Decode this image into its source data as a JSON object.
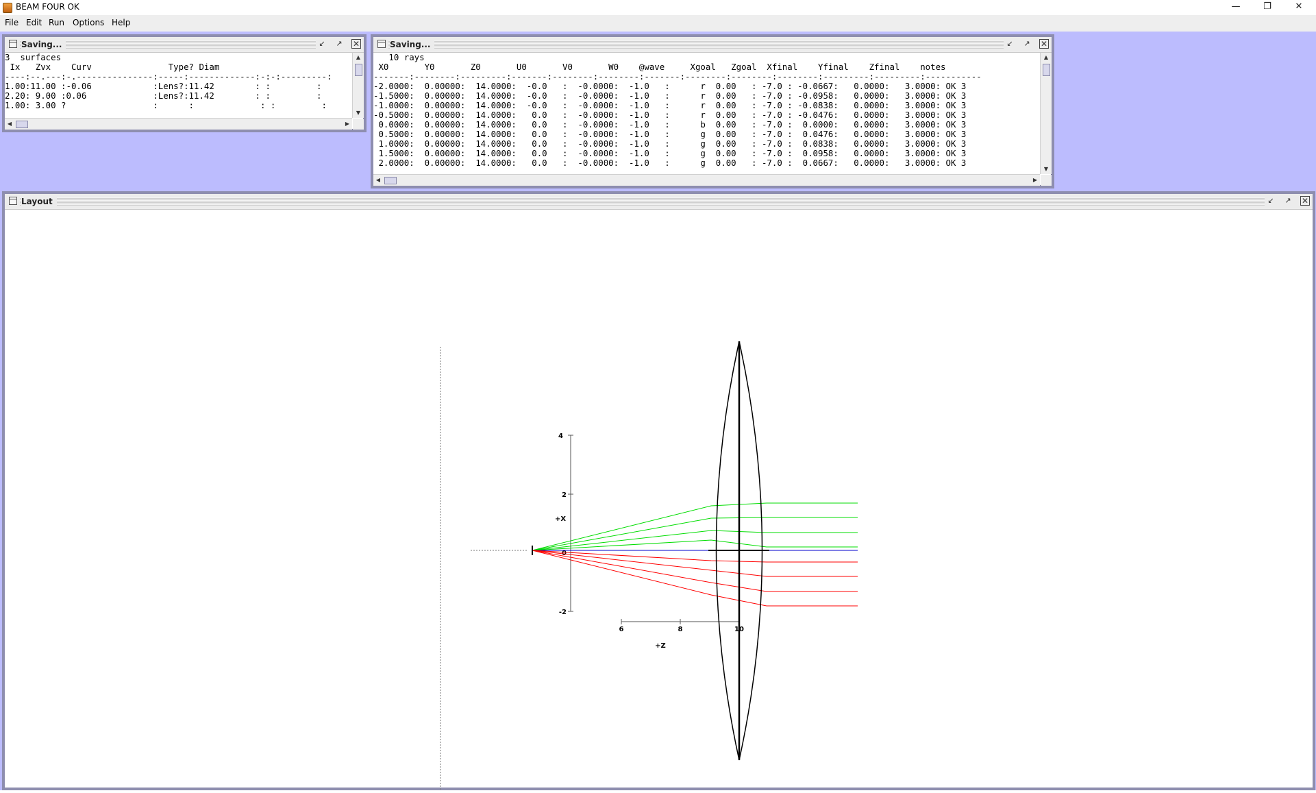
{
  "window": {
    "title": "BEAM FOUR  OK",
    "minimize_icon": "minimize-icon",
    "restore_icon": "restore-icon",
    "close_icon": "close-icon"
  },
  "menu": [
    "File",
    "Edit",
    "Run",
    "Options",
    "Help"
  ],
  "optics_frame": {
    "title": "Saving...",
    "lines": [
      "3  surfaces",
      " Ix   Zvx    Curv               Type? Diam",
      "----:--.---:-.---------------:-----:-------------:-:-:---------:",
      "1.00:11.00 :-0.06            :Lens?:11.42        : :         :",
      "2.20: 9.00 :0.06             :Lens?:11.42        : :         :",
      "1.00: 3.00 ?                 :      :             : :         :"
    ]
  },
  "rays_frame": {
    "title": "Saving...",
    "lines": [
      "   10 rays",
      " X0       Y0       Z0       U0       V0       W0    @wave     Xgoal   Zgoal  Xfinal    Yfinal    Zfinal    notes",
      "-------:--------:---------:-------:--------:--------:-------:--------:--------:--------:---------:---------:-----------",
      "-2.0000:  0.00000:  14.0000:  -0.0   :  -0.0000:  -1.0   :      r  0.00   : -7.0 : -0.0667:   0.0000:   3.0000: OK 3",
      "-1.5000:  0.00000:  14.0000:  -0.0   :  -0.0000:  -1.0   :      r  0.00   : -7.0 : -0.0958:   0.0000:   3.0000: OK 3",
      "-1.0000:  0.00000:  14.0000:  -0.0   :  -0.0000:  -1.0   :      r  0.00   : -7.0 : -0.0838:   0.0000:   3.0000: OK 3",
      "-0.5000:  0.00000:  14.0000:   0.0   :  -0.0000:  -1.0   :      r  0.00   : -7.0 : -0.0476:   0.0000:   3.0000: OK 3",
      " 0.0000:  0.00000:  14.0000:   0.0   :  -0.0000:  -1.0   :      b  0.00   : -7.0 :  0.0000:   0.0000:   3.0000: OK 3",
      " 0.5000:  0.00000:  14.0000:   0.0   :  -0.0000:  -1.0   :      g  0.00   : -7.0 :  0.0476:   0.0000:   3.0000: OK 3",
      " 1.0000:  0.00000:  14.0000:   0.0   :  -0.0000:  -1.0   :      g  0.00   : -7.0 :  0.0838:   0.0000:   3.0000: OK 3",
      " 1.5000:  0.00000:  14.0000:   0.0   :  -0.0000:  -1.0   :      g  0.00   : -7.0 :  0.0958:   0.0000:   3.0000: OK 3",
      " 2.0000:  0.00000:  14.0000:   0.0   :  -0.0000:  -1.0   :      g  0.00   : -7.0 :  0.0667:   0.0000:   3.0000: OK 3"
    ]
  },
  "layout_frame": {
    "title": "Layout",
    "x_axis_label": "+X",
    "z_axis_label": "+Z",
    "x_ticks": [
      "4",
      "2",
      "0",
      "-2"
    ],
    "z_ticks": [
      "6",
      "8",
      "10"
    ],
    "ray_colors": {
      "red": "#ff0000",
      "green": "#00dd00",
      "blue": "#0000cc",
      "lens": "#000000"
    }
  }
}
